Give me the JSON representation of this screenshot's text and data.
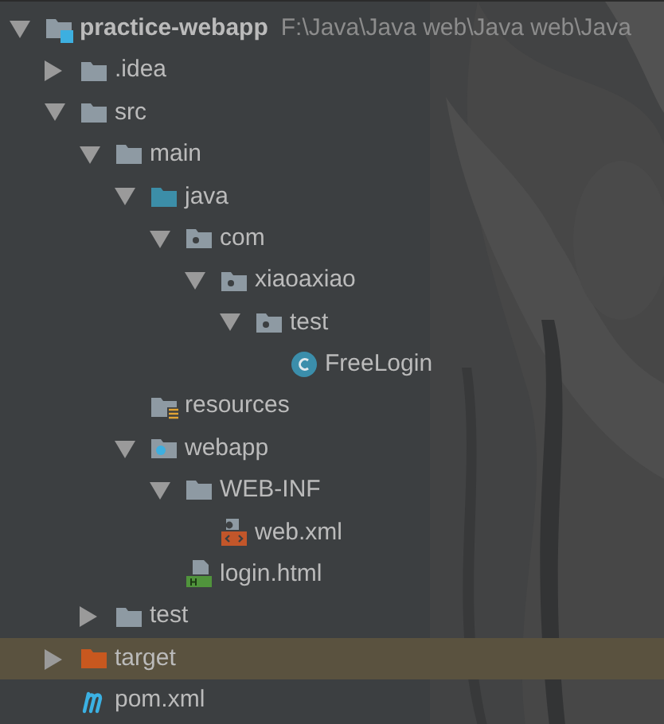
{
  "tree": [
    {
      "kind": "module",
      "name": "practice-webapp",
      "path": "F:\\Java\\Java web\\Java web\\Java",
      "expanded": true,
      "highlighted": false,
      "children": [
        {
          "kind": "folder",
          "name": ".idea",
          "expanded": false,
          "highlighted": false
        },
        {
          "kind": "folder",
          "name": "src",
          "expanded": true,
          "highlighted": false,
          "children": [
            {
              "kind": "folder",
              "name": "main",
              "expanded": true,
              "highlighted": false,
              "children": [
                {
                  "kind": "source",
                  "name": "java",
                  "expanded": true,
                  "highlighted": false,
                  "children": [
                    {
                      "kind": "package",
                      "name": "com",
                      "expanded": true,
                      "highlighted": false,
                      "children": [
                        {
                          "kind": "package",
                          "name": "xiaoaxiao",
                          "expanded": true,
                          "highlighted": false,
                          "children": [
                            {
                              "kind": "package",
                              "name": "test",
                              "expanded": true,
                              "highlighted": false,
                              "children": [
                                {
                                  "kind": "class",
                                  "name": "FreeLogin",
                                  "highlighted": false
                                }
                              ]
                            }
                          ]
                        }
                      ]
                    }
                  ]
                },
                {
                  "kind": "resources",
                  "name": "resources",
                  "highlighted": false
                },
                {
                  "kind": "web",
                  "name": "webapp",
                  "expanded": true,
                  "highlighted": false,
                  "children": [
                    {
                      "kind": "folder",
                      "name": "WEB-INF",
                      "expanded": true,
                      "highlighted": false,
                      "children": [
                        {
                          "kind": "xml",
                          "name": "web.xml",
                          "highlighted": false
                        }
                      ]
                    },
                    {
                      "kind": "html",
                      "name": "login.html",
                      "highlighted": false
                    }
                  ]
                }
              ]
            },
            {
              "kind": "folder",
              "name": "test",
              "expanded": false,
              "highlighted": false
            }
          ]
        },
        {
          "kind": "excluded",
          "name": "target",
          "expanded": false,
          "highlighted": true
        },
        {
          "kind": "maven",
          "name": "pom.xml",
          "highlighted": false
        }
      ]
    }
  ]
}
